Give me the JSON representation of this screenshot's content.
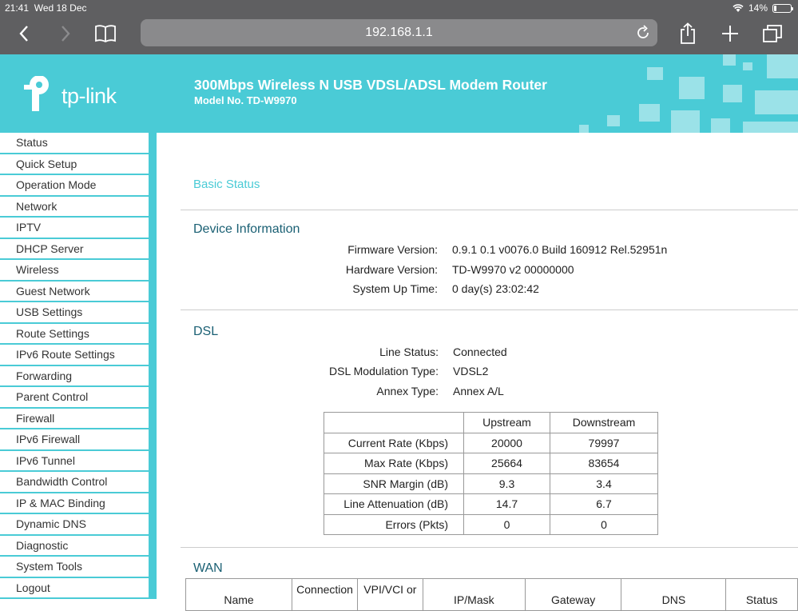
{
  "status_bar": {
    "time": "21:41",
    "date": "Wed 18 Dec",
    "battery": "14%"
  },
  "browser": {
    "url": "192.168.1.1"
  },
  "header": {
    "logo_text": "tp-link",
    "title": "300Mbps Wireless N USB VDSL/ADSL Modem Router",
    "model": "Model No. TD-W9970"
  },
  "sidebar": {
    "items": [
      {
        "label": "Status"
      },
      {
        "label": "Quick Setup"
      },
      {
        "label": "Operation Mode"
      },
      {
        "label": "Network"
      },
      {
        "label": "IPTV"
      },
      {
        "label": "DHCP Server"
      },
      {
        "label": "Wireless"
      },
      {
        "label": "Guest Network"
      },
      {
        "label": "USB Settings"
      },
      {
        "label": "Route Settings"
      },
      {
        "label": "IPv6 Route Settings"
      },
      {
        "label": "Forwarding"
      },
      {
        "label": "Parent Control"
      },
      {
        "label": "Firewall"
      },
      {
        "label": "IPv6 Firewall"
      },
      {
        "label": "IPv6 Tunnel"
      },
      {
        "label": "Bandwidth Control"
      },
      {
        "label": "IP & MAC Binding"
      },
      {
        "label": "Dynamic DNS"
      },
      {
        "label": "Diagnostic"
      },
      {
        "label": "System Tools"
      },
      {
        "label": "Logout"
      }
    ]
  },
  "main": {
    "page_title": "Basic Status",
    "device_info": {
      "title": "Device Information",
      "rows": [
        {
          "label": "Firmware Version:",
          "value": "0.9.1 0.1 v0076.0 Build 160912 Rel.52951n"
        },
        {
          "label": "Hardware Version:",
          "value": "TD-W9970 v2 00000000"
        },
        {
          "label": "System Up Time:",
          "value": "0 day(s) 23:02:42"
        }
      ]
    },
    "dsl": {
      "title": "DSL",
      "rows": [
        {
          "label": "Line Status:",
          "value": "Connected"
        },
        {
          "label": "DSL Modulation Type:",
          "value": "VDSL2"
        },
        {
          "label": "Annex Type:",
          "value": "Annex A/L"
        }
      ],
      "table": {
        "headers": [
          "",
          "Upstream",
          "Downstream"
        ],
        "rows": [
          {
            "label": "Current Rate (Kbps)",
            "up": "20000",
            "down": "79997"
          },
          {
            "label": "Max Rate (Kbps)",
            "up": "25664",
            "down": "83654"
          },
          {
            "label": "SNR Margin (dB)",
            "up": "9.3",
            "down": "3.4"
          },
          {
            "label": "Line Attenuation (dB)",
            "up": "14.7",
            "down": "6.7"
          },
          {
            "label": "Errors (Pkts)",
            "up": "0",
            "down": "0"
          }
        ]
      }
    },
    "wan": {
      "title": "WAN",
      "headers": [
        "Name",
        "Connection",
        "VPI/VCI or",
        "IP/Mask",
        "Gateway",
        "DNS",
        "Status"
      ]
    }
  }
}
